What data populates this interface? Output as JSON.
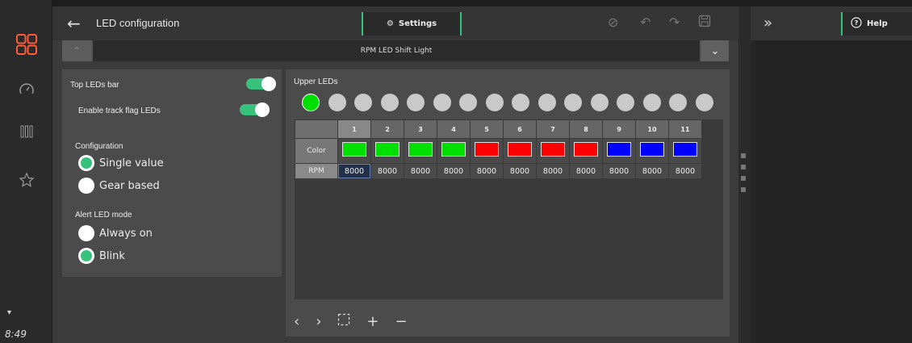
{
  "window": {
    "title": "LED configuration",
    "settings_tab": "Settings",
    "help_tab": "Help",
    "time": "8:49"
  },
  "titlebar": {
    "label": "RPM LED Shift Light"
  },
  "settings": {
    "top_leds_bar": {
      "label": "Top LEDs bar",
      "on": true
    },
    "enable_track_flag": {
      "label": "Enable track flag LEDs",
      "on": true
    },
    "configuration_heading": "Configuration",
    "config_options": [
      {
        "label": "Single value",
        "selected": true
      },
      {
        "label": "Gear based",
        "selected": false
      }
    ],
    "alert_heading": "Alert LED mode",
    "alert_options": [
      {
        "label": "Always on",
        "selected": false
      },
      {
        "label": "Blink",
        "selected": true
      }
    ]
  },
  "upper_leds": {
    "heading": "Upper LEDs",
    "leds": [
      "green",
      "off",
      "off",
      "off",
      "off",
      "off",
      "off",
      "off",
      "off",
      "off",
      "off",
      "off",
      "off",
      "off",
      "off",
      "off"
    ]
  },
  "grid": {
    "row_labels": {
      "color": "Color",
      "rpm": "RPM"
    },
    "columns": [
      "1",
      "2",
      "3",
      "4",
      "5",
      "6",
      "7",
      "8",
      "9",
      "10",
      "11"
    ],
    "colors": [
      "#00e000",
      "#00e000",
      "#00e000",
      "#00e000",
      "#ff0000",
      "#ff0000",
      "#ff0000",
      "#ff0000",
      "#0000ff",
      "#0000ff",
      "#0000ff"
    ],
    "rpm": [
      "8000",
      "8000",
      "8000",
      "8000",
      "8000",
      "8000",
      "8000",
      "8000",
      "8000",
      "8000",
      "8000"
    ]
  },
  "colors": {
    "accent": "#37c27c",
    "brand": "#ff5a3c"
  }
}
